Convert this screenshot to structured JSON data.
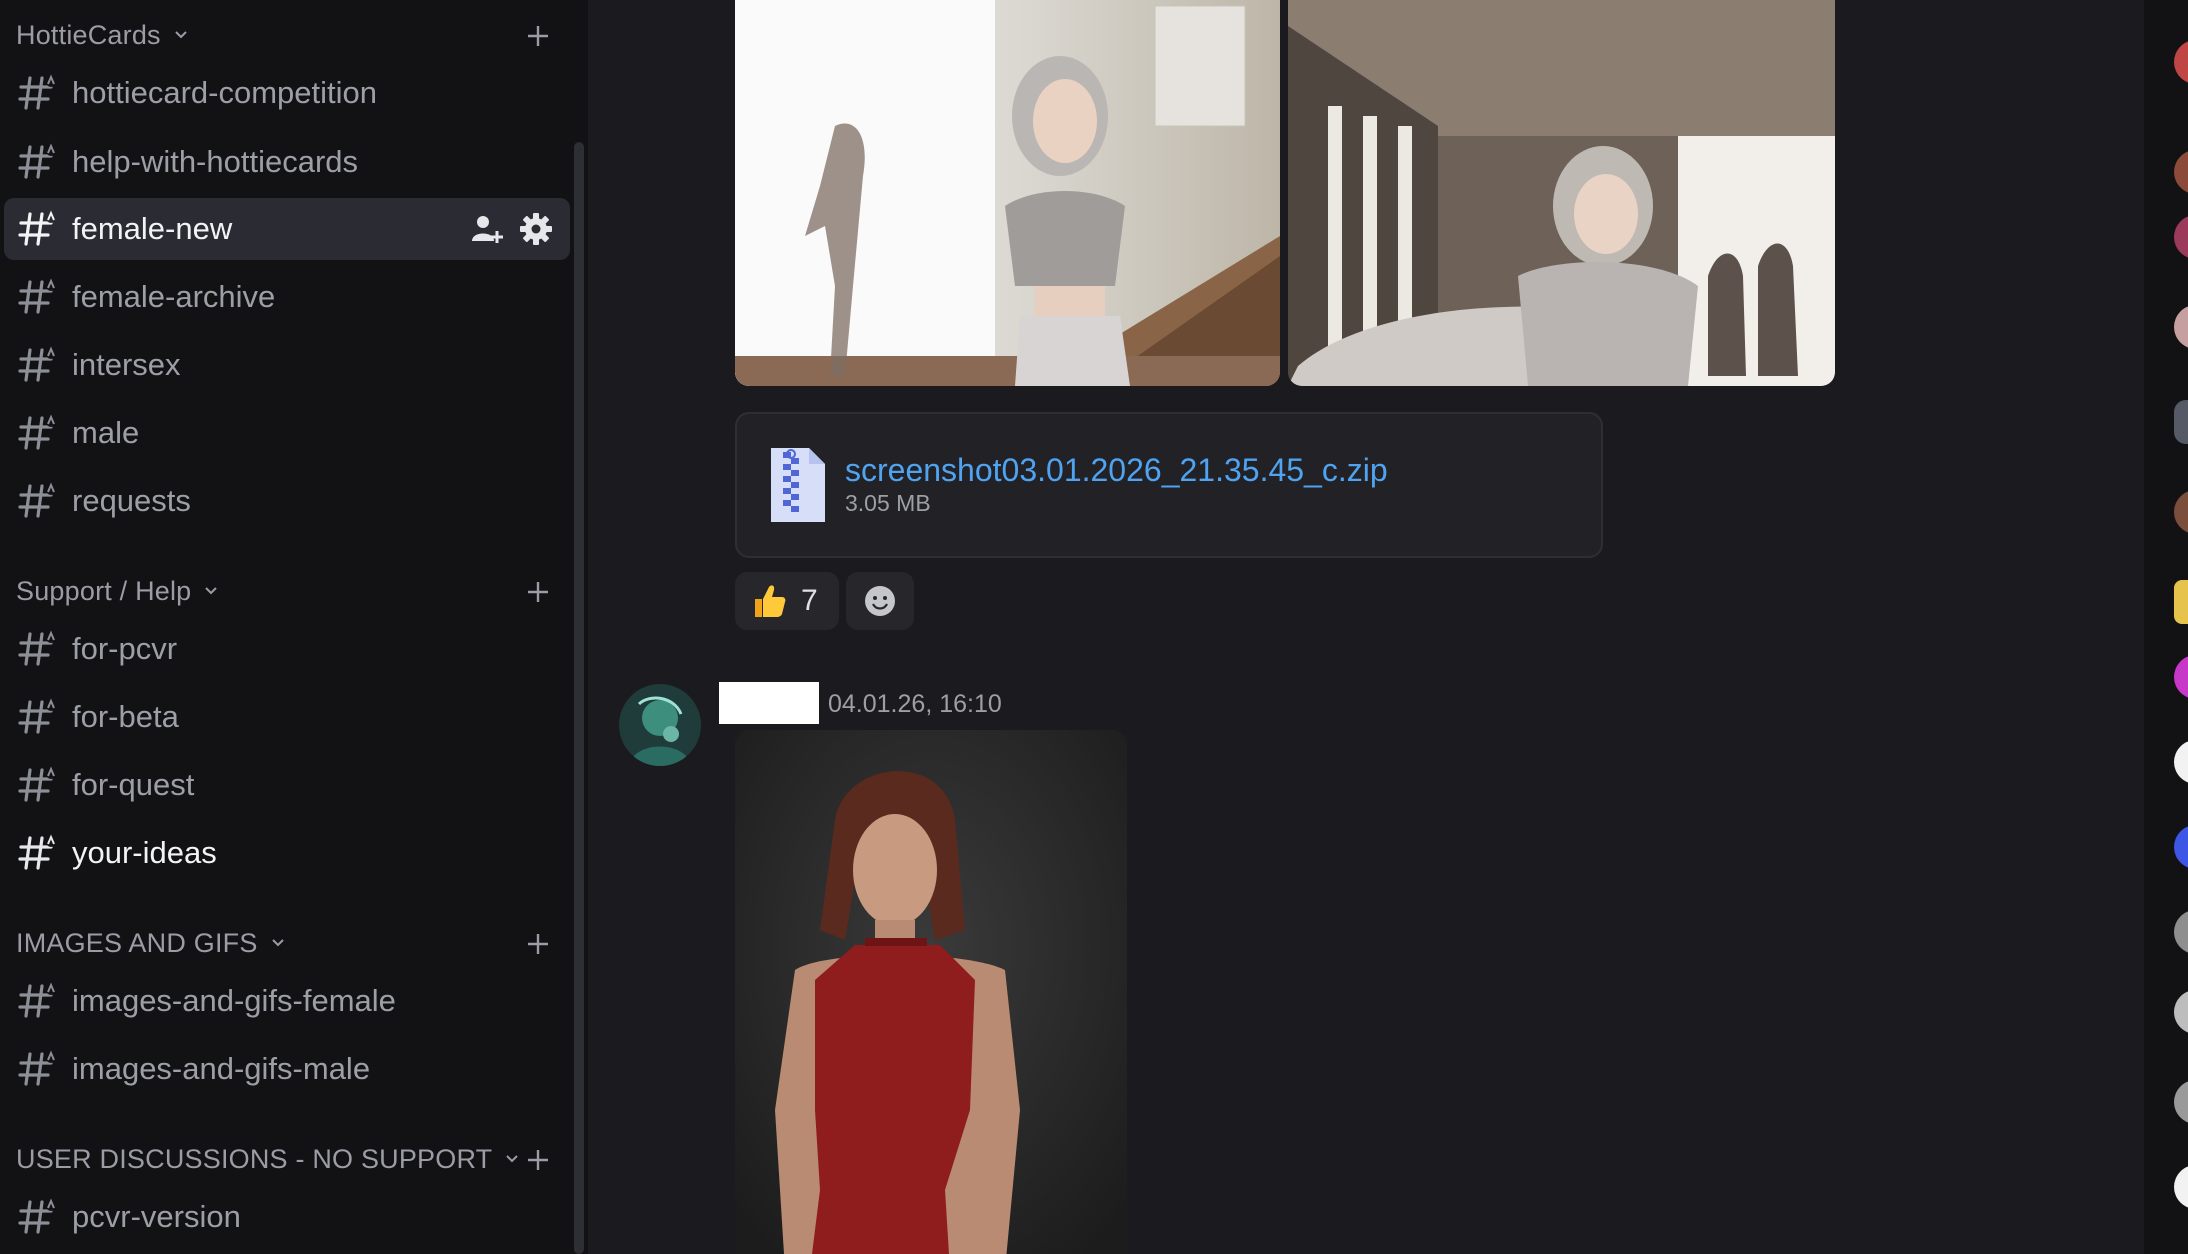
{
  "sidebar": {
    "categories": [
      {
        "label": "HottieCards"
      },
      {
        "label": "Support / Help"
      },
      {
        "label": "IMAGES AND GIFS"
      },
      {
        "label": "USER DISCUSSIONS - NO SUPPORT"
      }
    ],
    "channels": [
      {
        "label": "hottiecard-competition"
      },
      {
        "label": "help-with-hottiecards"
      },
      {
        "label": "female-new",
        "selected": true
      },
      {
        "label": "female-archive"
      },
      {
        "label": "intersex"
      },
      {
        "label": "male"
      },
      {
        "label": "requests"
      },
      {
        "label": "for-pcvr"
      },
      {
        "label": "for-beta"
      },
      {
        "label": "for-quest"
      },
      {
        "label": "your-ideas",
        "unread": true
      },
      {
        "label": "images-and-gifs-female"
      },
      {
        "label": "images-and-gifs-male"
      },
      {
        "label": "pcvr-version"
      }
    ]
  },
  "message": {
    "attachment": {
      "file_name": "screenshot03.01.2026_21.35.45_c.zip",
      "file_size": "3.05 MB"
    },
    "reactions": [
      {
        "emoji": "thumbs-up",
        "count": "7"
      }
    ]
  },
  "next_message": {
    "timestamp": "04.01.26, 16:10"
  },
  "colors": {
    "accent_link": "#4fa3f0",
    "selected_bg": "#2b2c33",
    "sidebar_bg": "#121214",
    "main_bg": "#1b1b1f"
  }
}
